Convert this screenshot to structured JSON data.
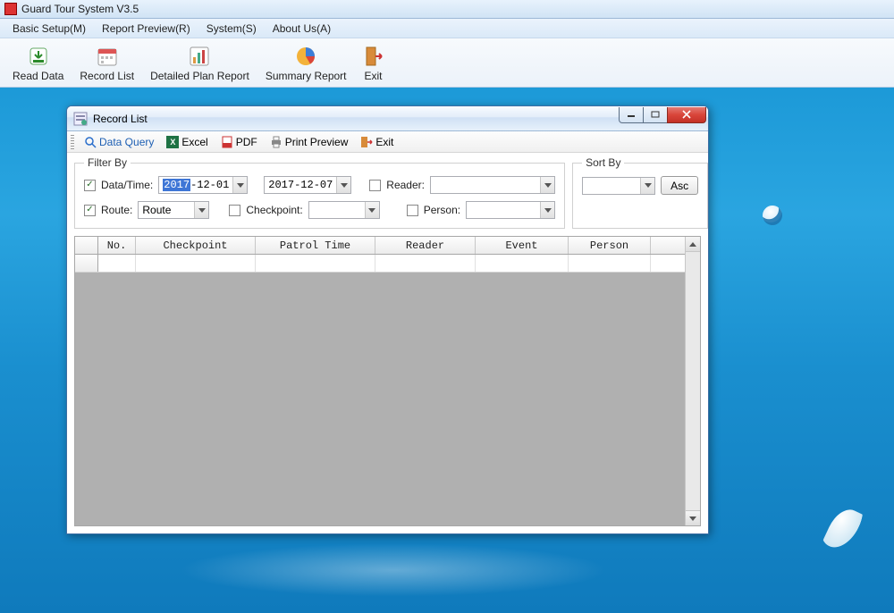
{
  "app": {
    "title": "Guard Tour System V3.5"
  },
  "menubar": {
    "basic_setup": "Basic Setup(M)",
    "report_preview": "Report Preview(R)",
    "system": "System(S)",
    "about_us": "About Us(A)"
  },
  "toolbar": {
    "read_data": "Read Data",
    "record_list": "Record List",
    "detailed_plan_report": "Detailed Plan Report",
    "summary_report": "Summary Report",
    "exit": "Exit"
  },
  "child": {
    "title": "Record List",
    "toolbar": {
      "data_query": "Data Query",
      "excel": "Excel",
      "pdf": "PDF",
      "print_preview": "Print Preview",
      "exit": "Exit"
    },
    "filter": {
      "legend": "Filter By",
      "datetime_label": "Data/Time:",
      "date_from_year": "2017",
      "date_from_rest": "-12-01",
      "date_to": "2017-12-07",
      "reader_label": "Reader:",
      "route_label": "Route:",
      "route_value": "Route",
      "checkpoint_label": "Checkpoint:",
      "person_label": "Person:"
    },
    "sort": {
      "legend": "Sort By",
      "asc": "Asc"
    },
    "grid": {
      "headers": {
        "no": "No.",
        "checkpoint": "Checkpoint",
        "patrol_time": "Patrol Time",
        "reader": "Reader",
        "event": "Event",
        "person": "Person"
      }
    }
  }
}
